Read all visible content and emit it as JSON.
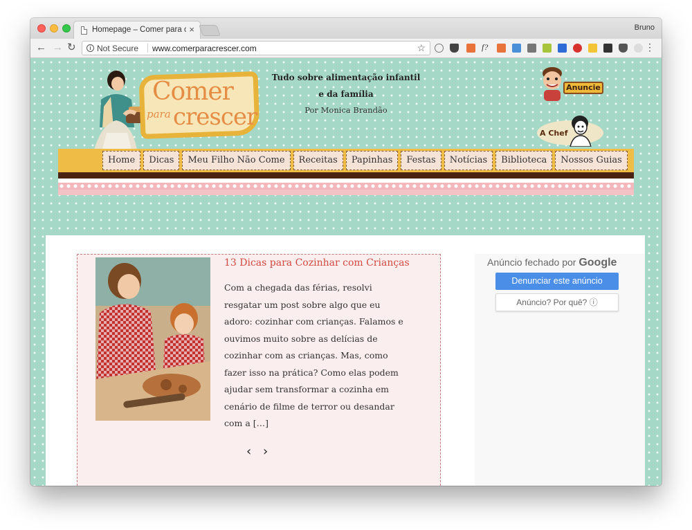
{
  "browser": {
    "tab_title": "Homepage – Comer para cresc",
    "tab_close": "×",
    "profile_name": "Bruno",
    "security_label": "Not Secure",
    "url": "www.comerparacrescer.com",
    "ext_font_label": "f?"
  },
  "header": {
    "tagline": "Tudo sobre alimentação infantil e da família",
    "author": "Por Monica Brandão",
    "logo_line1": "Comer",
    "logo_line2": "para",
    "logo_line3": "crescer",
    "badge_anuncie": "Anuncie",
    "badge_chef": "A Chef"
  },
  "nav": {
    "items": [
      "Home",
      "Dicas",
      "Meu Filho Não Come",
      "Receitas",
      "Papinhas",
      "Festas",
      "Notícias",
      "Biblioteca",
      "Nossos Guias"
    ]
  },
  "post": {
    "title": "13 Dicas para Cozinhar com Crianças",
    "excerpt": "  Com a chegada das férias, resolvi resgatar um post sobre algo que eu adoro: cozinhar com crianças.   Falamos e ouvimos muito sobre as delícias de cozinhar com as crianças. Mas, como fazer isso na prática? Como elas podem ajudar sem transformar a cozinha em cenário de filme de terror ou desandar com a […]",
    "prev": "‹",
    "next": "›"
  },
  "ad": {
    "closed_by": "Anúncio fechado por",
    "google": "Google",
    "report_button": "Denunciar este anúncio",
    "why_button": "Anúncio? Por quê? ⓘ"
  },
  "colors": {
    "background": "#a5d8c6",
    "nav_yellow": "#efbc45",
    "title_red": "#d3483f",
    "card_pink": "#fbeeee",
    "ad_blue": "#4a8ee8"
  }
}
